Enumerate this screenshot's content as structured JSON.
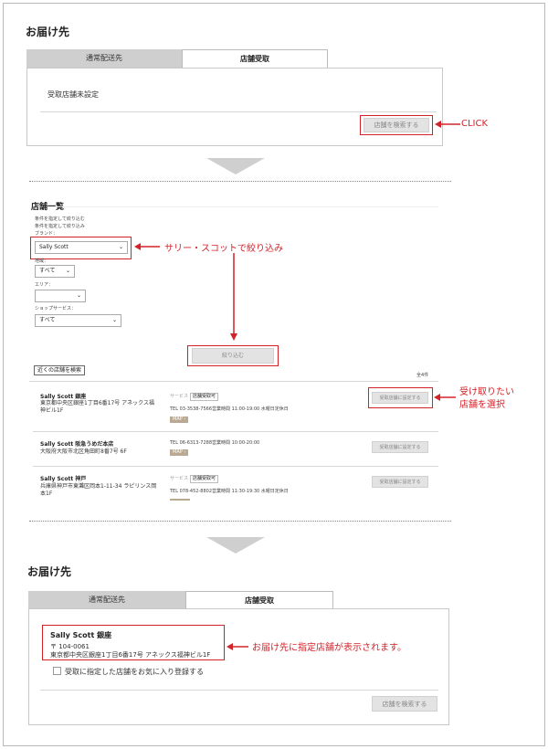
{
  "section1": {
    "title": "お届け先",
    "tabs": [
      "通常配送先",
      "店舗受取"
    ],
    "pickup_status": "受取店舗未設定",
    "search_button": "店舗を検索する",
    "callout": "CLICK"
  },
  "section2": {
    "title": "店舗一覧",
    "filter_lines": [
      "条件を指定して絞り込む",
      "条件を指定して絞り込み",
      "ブランド："
    ],
    "brand_select": "Sally Scott",
    "brand_callout": "サリー・スコットで絞り込み",
    "pref_label": "地域：",
    "pref_select": "すべて",
    "area_label": "エリア：",
    "area_select": "",
    "service_label": "ショップサービス：",
    "service_select": "すべて",
    "filter_button": "絞り込む",
    "nearby_button": "近くの店舗を検索",
    "count": "全4件",
    "select_callout": [
      "受け取りたい",
      "店舗を選択"
    ],
    "stores": [
      {
        "name": "Sally Scott 銀座",
        "address": [
          "東京都中央区銀座1丁目6番17号 アネックス福",
          "神ビル1F"
        ],
        "service_label": "サービス",
        "service": "店舗受取可",
        "tel": "TEL 03-3538-7566",
        "hours": "営業時間 11:00-19:00 水曜日定休日",
        "map": "MAP ›",
        "button": "受取店舗に設定する"
      },
      {
        "name": "Sally Scott 阪急うめだ本店",
        "address": [
          "大阪府大阪市北区角田町8番7号 6F"
        ],
        "service_label": "",
        "service": "",
        "tel": "TEL 06-6313-7288",
        "hours": "営業時間 10:00-20:00",
        "map": "MAP ›",
        "button": "受取店舗に設定する"
      },
      {
        "name": "Sally Scott 神戸",
        "address": [
          "兵庫県神戸市東灘区岡本1-11-34 ラピリンス岡",
          "本1F"
        ],
        "service_label": "サービス",
        "service": "店舗受取可",
        "tel": "TEL 078-452-8802",
        "hours": "営業時間 11:30-19:30 水曜日定休日",
        "map": "",
        "button": "受取店舗に設定する"
      }
    ]
  },
  "section3": {
    "title": "お届け先",
    "tabs": [
      "通常配送先",
      "店舗受取"
    ],
    "store_name": "Sally Scott 銀座",
    "postal": "〒 104-0061",
    "address": "東京都中央区銀座1丁目6番17号 アネックス福神ビル1F",
    "favorite_label": "受取に指定した店舗をお気に入り登録する",
    "search_button": "店舗を検索する",
    "callout": "お届け先に指定店舗が表示されます。"
  },
  "colors": {
    "accent": "#d3232a",
    "tab_inactive": "#cfcfcf",
    "map_tag": "#b9a993"
  }
}
